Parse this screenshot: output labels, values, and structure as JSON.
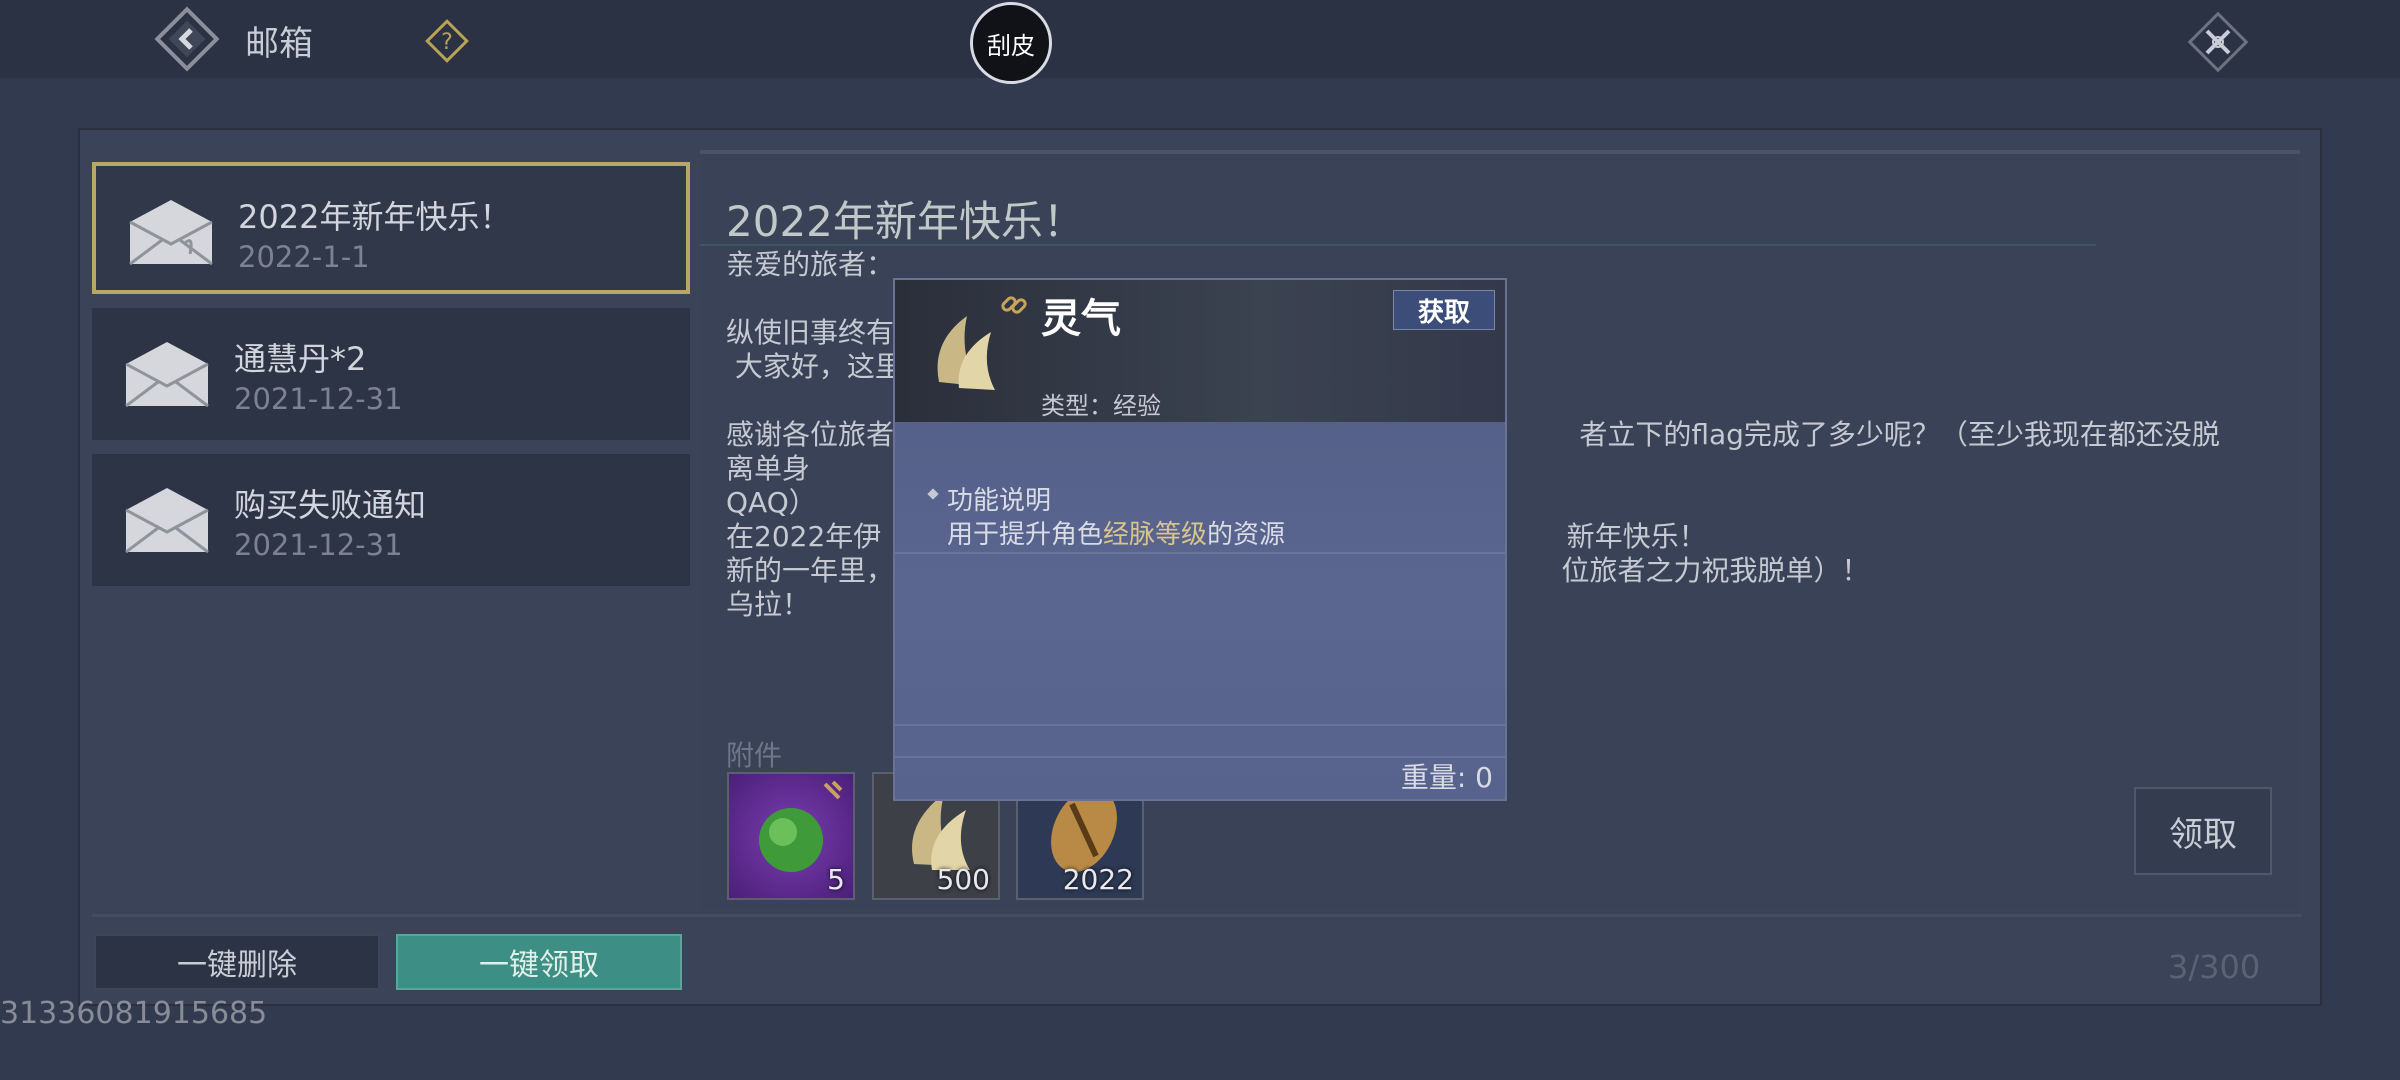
{
  "header": {
    "title": "邮箱",
    "scrape_label": "刮皮"
  },
  "mail_list": [
    {
      "title": "2022年新年快乐！",
      "date": "2022-1-1",
      "selected": true
    },
    {
      "title": "通慧丹*2",
      "date": "2021-12-31",
      "selected": false
    },
    {
      "title": "购买失败通知",
      "date": "2021-12-31",
      "selected": false
    }
  ],
  "mail": {
    "heading": "2022年新年快乐！",
    "body": "亲爱的旅者：\n\n纵使旧事终有\n 大家好，这里\n\n感谢各位旅者                                                                             者立下的flag完成了多少呢？（至少我现在都还没脱离单身\nQAQ）\n在2022年伊                                                                             新年快乐！\n新的一年里，                                                                           位旅者之力祝我脱单）！\n乌拉！",
    "attachments_label": "附件",
    "attachments": [
      {
        "count": "5"
      },
      {
        "count": "500"
      },
      {
        "count": "2022"
      }
    ],
    "claim_label": "领取"
  },
  "footer": {
    "delete_all_label": "一键删除",
    "claim_all_label": "一键领取",
    "capacity": "3/300"
  },
  "uid": "31336081915685",
  "popup": {
    "name": "灵气",
    "get_label": "获取",
    "type": "类型：经验",
    "section_title": "功能说明",
    "desc_before": "用于提升角色",
    "desc_highlight": "经脉等级",
    "desc_after": "的资源",
    "weight": "重量: 0"
  },
  "colors": {
    "selected_border": "#b7a86a",
    "claim_all_bg": "#3d8f85",
    "highlight": "#d9c48a"
  }
}
